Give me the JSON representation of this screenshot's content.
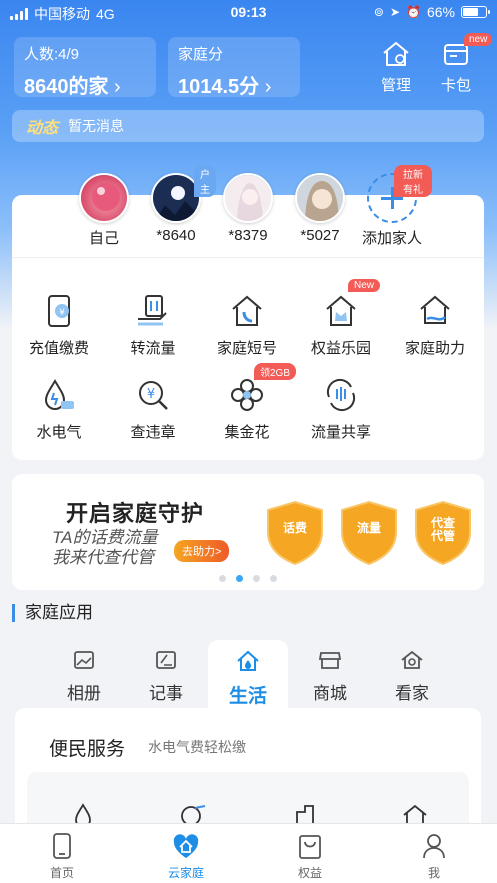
{
  "status_bar": {
    "carrier": "中国移动",
    "network": "4G",
    "time": "09:13",
    "battery": "66%"
  },
  "family": {
    "members_label": "人数:4/9",
    "family_name": "8640的家",
    "score_label": "家庭分",
    "score_value": "1014.5分"
  },
  "top_actions": {
    "manage": "管理",
    "wallet": "卡包",
    "wallet_badge": "new"
  },
  "news": {
    "label": "动态",
    "message": "暂无消息"
  },
  "members": [
    {
      "name": "自己",
      "tag": ""
    },
    {
      "name": "*8640",
      "tag": "户主"
    },
    {
      "name": "*8379",
      "tag": ""
    },
    {
      "name": "*5027",
      "tag": ""
    },
    {
      "name": "添加家人",
      "tag": "拉新有礼"
    }
  ],
  "services": [
    {
      "label": "充值缴费",
      "icon": "recharge-icon",
      "badge": ""
    },
    {
      "label": "转流量",
      "icon": "transfer-data-icon",
      "badge": ""
    },
    {
      "label": "家庭短号",
      "icon": "family-shortnumber-icon",
      "badge": ""
    },
    {
      "label": "权益乐园",
      "icon": "benefits-park-icon",
      "badge": "New"
    },
    {
      "label": "家庭助力",
      "icon": "family-help-icon",
      "badge": ""
    },
    {
      "label": "水电气",
      "icon": "utilities-icon",
      "badge": ""
    },
    {
      "label": "查违章",
      "icon": "traffic-violation-icon",
      "badge": ""
    },
    {
      "label": "集金花",
      "icon": "collect-flower-icon",
      "badge": "领2GB"
    },
    {
      "label": "流量共享",
      "icon": "data-share-icon",
      "badge": ""
    }
  ],
  "banner": {
    "title": "开启家庭守护",
    "line1": "TA的话费流量",
    "line2": "我来代查代管",
    "button": "去助力>",
    "shields": [
      "话费",
      "流量",
      "代查\n代管"
    ],
    "dots": 4,
    "active_dot": 1
  },
  "section": {
    "title": "家庭应用"
  },
  "tabs": [
    {
      "label": "相册",
      "icon": "photo-album-icon"
    },
    {
      "label": "记事",
      "icon": "notes-icon"
    },
    {
      "label": "生活",
      "icon": "life-icon",
      "active": true
    },
    {
      "label": "商城",
      "icon": "mall-icon"
    },
    {
      "label": "看家",
      "icon": "home-watch-icon"
    }
  ],
  "service_card": {
    "title": "便民服务",
    "subtitle": "水电气费轻松缴"
  },
  "bottom_nav": [
    {
      "label": "首页",
      "icon": "home-phone-icon"
    },
    {
      "label": "云家庭",
      "icon": "cloud-family-icon",
      "active": true
    },
    {
      "label": "权益",
      "icon": "benefits-bag-icon"
    },
    {
      "label": "我",
      "icon": "profile-icon"
    }
  ],
  "colors": {
    "accent": "#1d8de6",
    "badge_red": "#f35b57",
    "hero_blue": "#3a86f0",
    "shield_orange": "#f5a623"
  }
}
